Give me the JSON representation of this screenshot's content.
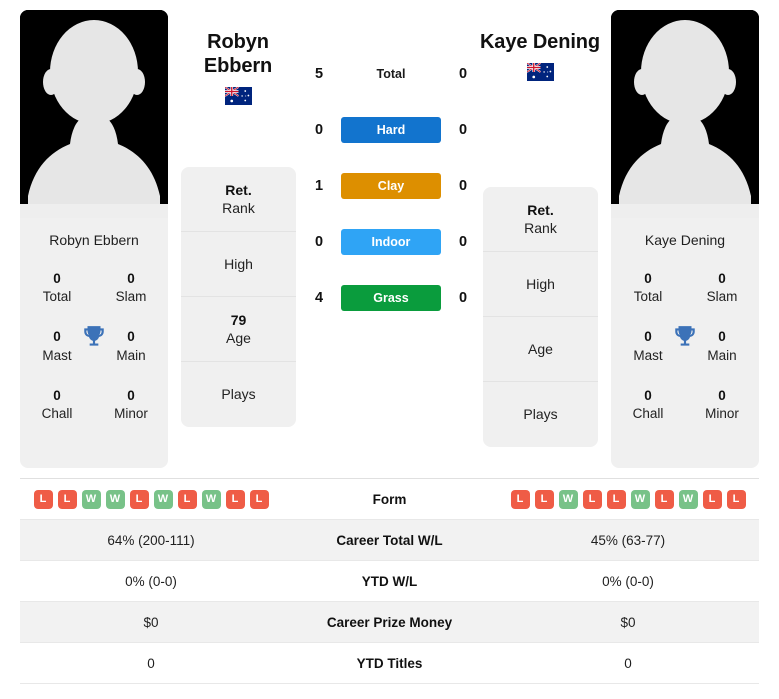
{
  "players": {
    "left": {
      "name": "Robyn Ebbern",
      "name_line1": "Robyn",
      "name_line2": "Ebbern",
      "flag": "australia-flag",
      "avatar": "player-silhouette-placeholder",
      "titles": {
        "total_val": "0",
        "total_lbl": "Total",
        "slam_val": "0",
        "slam_lbl": "Slam",
        "mast_val": "0",
        "mast_lbl": "Mast",
        "main_val": "0",
        "main_lbl": "Main",
        "chall_val": "0",
        "chall_lbl": "Chall",
        "minor_val": "0",
        "minor_lbl": "Minor"
      },
      "info": {
        "rank_val": "Ret.",
        "rank_lbl": "Rank",
        "high_val": "",
        "high_lbl": "High",
        "age_val": "79",
        "age_lbl": "Age",
        "plays_val": "",
        "plays_lbl": "Plays"
      },
      "form": [
        "L",
        "L",
        "W",
        "W",
        "L",
        "W",
        "L",
        "W",
        "L",
        "L"
      ],
      "career_wl": "64% (200-111)",
      "ytd_wl": "0% (0-0)",
      "prize_money": "$0",
      "ytd_titles": "0"
    },
    "right": {
      "name": "Kaye Dening",
      "name_line1": "Kaye Dening",
      "name_line2": "",
      "flag": "australia-flag",
      "avatar": "player-silhouette-placeholder",
      "titles": {
        "total_val": "0",
        "total_lbl": "Total",
        "slam_val": "0",
        "slam_lbl": "Slam",
        "mast_val": "0",
        "mast_lbl": "Mast",
        "main_val": "0",
        "main_lbl": "Main",
        "chall_val": "0",
        "chall_lbl": "Chall",
        "minor_val": "0",
        "minor_lbl": "Minor"
      },
      "info": {
        "rank_val": "Ret.",
        "rank_lbl": "Rank",
        "high_val": "",
        "high_lbl": "High",
        "age_val": "",
        "age_lbl": "Age",
        "plays_val": "",
        "plays_lbl": "Plays"
      },
      "form": [
        "L",
        "L",
        "W",
        "L",
        "L",
        "W",
        "L",
        "W",
        "L",
        "L"
      ],
      "career_wl": "45% (63-77)",
      "ytd_wl": "0% (0-0)",
      "prize_money": "$0",
      "ytd_titles": "0"
    }
  },
  "head_to_head": {
    "total": {
      "label": "Total",
      "left": "5",
      "right": "0",
      "color": ""
    },
    "surfaces": [
      {
        "label": "Hard",
        "left": "0",
        "right": "0",
        "color": "#1274ce"
      },
      {
        "label": "Clay",
        "left": "1",
        "right": "0",
        "color": "#dd8f00"
      },
      {
        "label": "Indoor",
        "left": "0",
        "right": "0",
        "color": "#2fa4f5"
      },
      {
        "label": "Grass",
        "left": "4",
        "right": "0",
        "color": "#0a9c3d"
      }
    ]
  },
  "stats_table": {
    "rows": [
      {
        "label": "Form",
        "type": "form"
      },
      {
        "label": "Career Total W/L",
        "type": "text",
        "left": "64% (200-111)",
        "right": "45% (63-77)"
      },
      {
        "label": "YTD W/L",
        "type": "text",
        "left": "0% (0-0)",
        "right": "0% (0-0)"
      },
      {
        "label": "Career Prize Money",
        "type": "text",
        "left": "$0",
        "right": "$0"
      },
      {
        "label": "YTD Titles",
        "type": "text",
        "left": "0",
        "right": "0"
      }
    ]
  },
  "colors": {
    "hard": "#1274ce",
    "clay": "#dd8f00",
    "indoor": "#2fa4f5",
    "grass": "#0a9c3d",
    "win_badge": "#78c288",
    "loss_badge": "#ef5c46",
    "trophy": "#3c72b8",
    "panel_bg": "#f0f0f0"
  }
}
